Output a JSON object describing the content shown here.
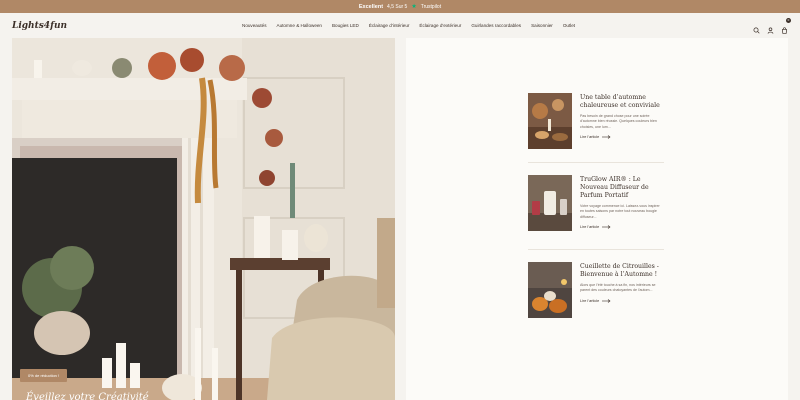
{
  "announcement": {
    "rating_label": "Excellent",
    "rating_value": "4,5 Sur 5",
    "star_icon": "star-icon",
    "trustpilot": "Trustpilot"
  },
  "header": {
    "logo": "Lights4fun",
    "nav": [
      "Nouveautés",
      "Automne & Halloween",
      "Bougies LED",
      "Éclairage d’intérieur",
      "Éclairage d’extérieur",
      "Guirlandes raccordables",
      "Saisonnier",
      "Outlet"
    ],
    "icons": [
      "search-icon",
      "account-icon",
      "cart-icon"
    ],
    "cart_count": "0"
  },
  "hero": {
    "badge": "0% de réduction !",
    "title": "Éveillez votre Créativité"
  },
  "articles": [
    {
      "title": "Une table d’automne chaleureuse et conviviale",
      "excerpt": "Pas besoin de grand chose pour une soirée d’automne bien réussie. Quelques couleurs bien choisies, une lum...",
      "link": "Lire l’article"
    },
    {
      "title": "TruGlow AIR® : Le Nouveau Diffuseur de Parfum Portatif",
      "excerpt": "Votre voyage commence ici. Laissez-vous inspirer en toutes saisons par notre tout nouveau bougie diffuseur...",
      "link": "Lire l’article"
    },
    {
      "title": "Cueillette de Citrouilles - Bienvenue à l’Automne !",
      "excerpt": "Alors que l’été touche à sa fin, nos intérieurs se parent des couleurs chatoyantes de l’autom...",
      "link": "Lire l’article"
    }
  ],
  "colors": {
    "accent": "#b08866",
    "text": "#3b2f28",
    "background": "#f5f3ef",
    "panel": "#fcfbf8"
  }
}
